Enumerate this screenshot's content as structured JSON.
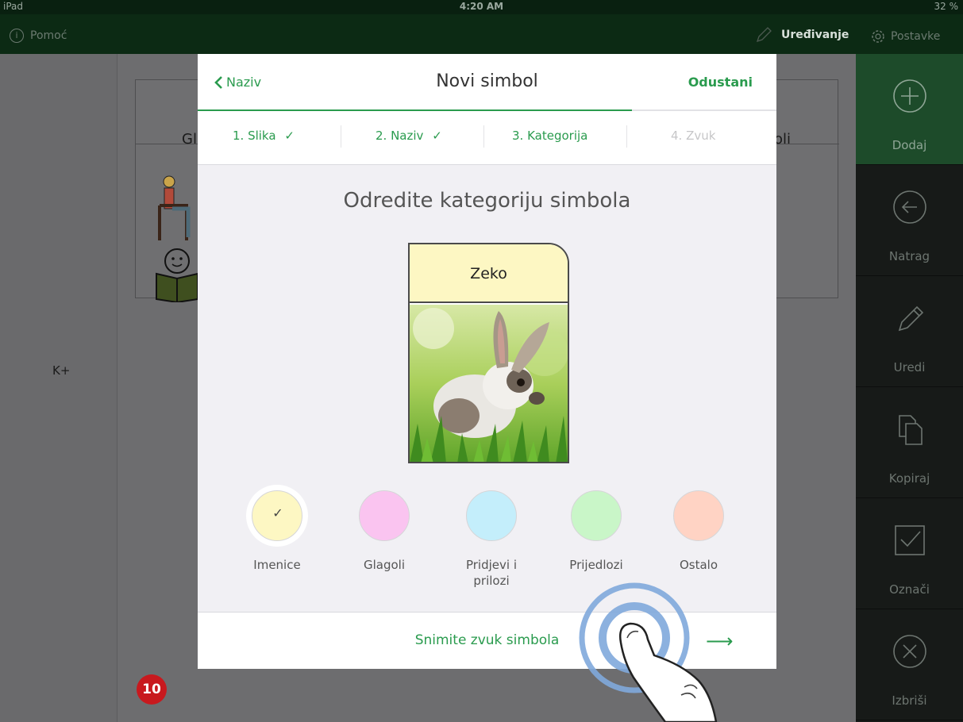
{
  "status_bar": {
    "device": "iPad",
    "time": "4:20 AM",
    "battery": "32 %"
  },
  "top_bar": {
    "help_label": "Pomoć",
    "edit_label": "Uređivanje",
    "settings_label": "Postavke"
  },
  "background": {
    "left_label": "K+",
    "card1_title": "Gl",
    "card2_title": "oli",
    "badge": "10"
  },
  "sidebar": {
    "items": [
      {
        "label": "Dodaj",
        "icon": "plus-circle-icon"
      },
      {
        "label": "Natrag",
        "icon": "back-arrow-circle-icon"
      },
      {
        "label": "Uredi",
        "icon": "pencil-icon"
      },
      {
        "label": "Kopiraj",
        "icon": "copy-icon"
      },
      {
        "label": "Označi",
        "icon": "checkbox-icon"
      },
      {
        "label": "Izbriši",
        "icon": "close-circle-icon"
      }
    ]
  },
  "modal": {
    "back_label": "Naziv",
    "title": "Novi simbol",
    "cancel_label": "Odustani",
    "progress_fraction": 0.75,
    "steps": [
      {
        "label": "1. Slika",
        "done": true
      },
      {
        "label": "2. Naziv",
        "done": true
      },
      {
        "label": "3. Kategorija",
        "done": false
      },
      {
        "label": "4. Zvuk",
        "done": false
      }
    ],
    "heading": "Odredite kategoriju simbola",
    "symbol": {
      "label": "Zeko"
    },
    "categories": [
      {
        "label": "Imenice",
        "color": "#fdf7c3",
        "selected": true
      },
      {
        "label": "Glagoli",
        "color": "#fac4f0"
      },
      {
        "label_line1": "Pridjevi i",
        "label_line2": "prilozi",
        "color": "#c4eefb"
      },
      {
        "label": "Prijedlozi",
        "color": "#c9f6c8"
      },
      {
        "label": "Ostalo",
        "color": "#ffd3c4"
      }
    ],
    "next_label": "Snimite zvuk simbola"
  },
  "colors": {
    "accent": "#2a9b4e",
    "toolbar_active": "#1d4b2a",
    "badge": "#c8191e"
  }
}
